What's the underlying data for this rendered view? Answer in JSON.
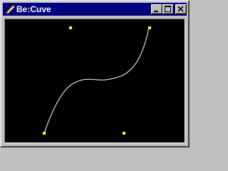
{
  "window": {
    "title": "Be:Cuve"
  },
  "titlebar": {
    "icon": "pencil-icon",
    "buttons": [
      "minimize-icon",
      "maximize-icon",
      "close-icon"
    ]
  },
  "canvas": {
    "background": "#000000",
    "curve_color": "#ffffff",
    "control_point_color": "#ffff00"
  }
}
